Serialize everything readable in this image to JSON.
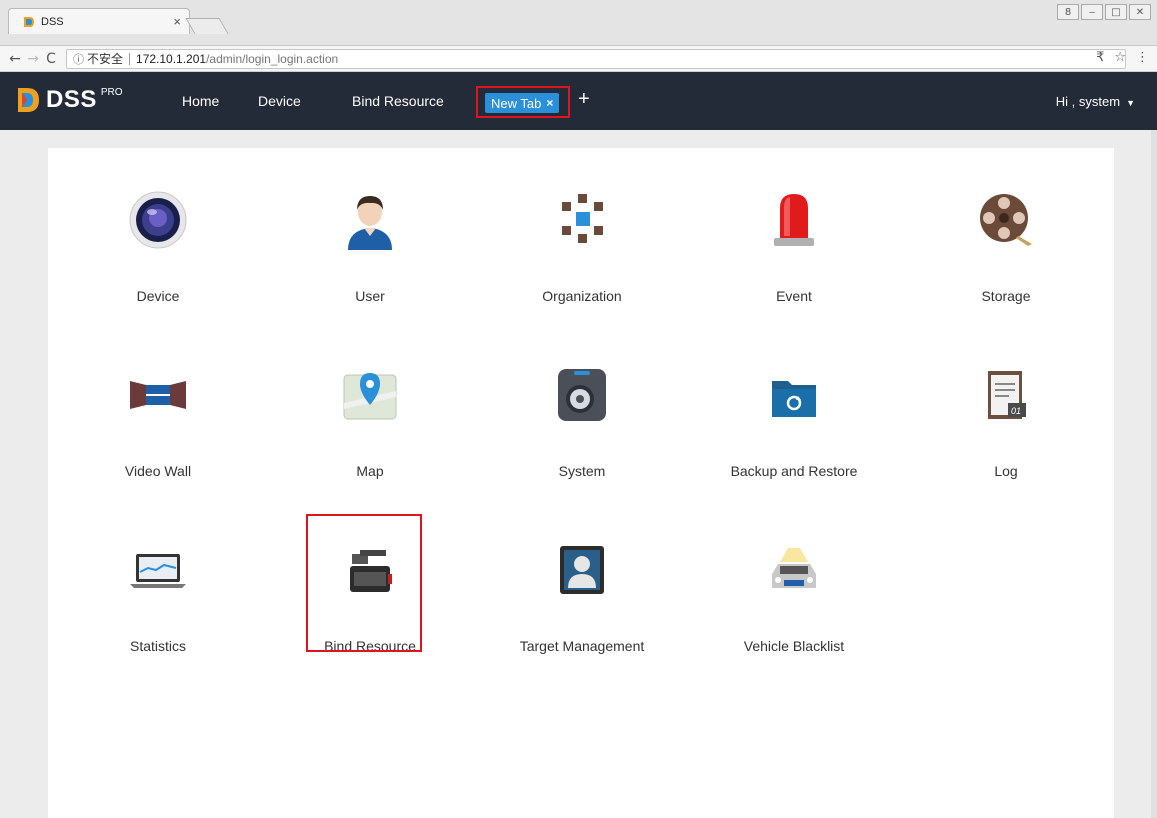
{
  "browser": {
    "tab_title": "DSS",
    "tab_close": "×",
    "security_text": "不安全",
    "url_host": "172.10.1.201",
    "url_path": "/admin/login_login.action",
    "win_buttons": [
      "8",
      "‒",
      "□",
      "✕"
    ]
  },
  "app": {
    "logo_text": "DSS",
    "logo_sup": "PRO",
    "nav": {
      "home": "Home",
      "device": "Device",
      "bind_resource": "Bind Resource",
      "new_tab": "New Tab",
      "new_tab_close": "×",
      "add": "+"
    },
    "user_greeting": "Hi , system",
    "colors": {
      "nav_bg": "#242b38",
      "accent": "#2a90d9",
      "highlight": "#e0141e"
    }
  },
  "modules": [
    {
      "label": "Device",
      "icon": "camera-lens-icon"
    },
    {
      "label": "User",
      "icon": "user-avatar-icon"
    },
    {
      "label": "Organization",
      "icon": "organization-cubes-icon"
    },
    {
      "label": "Event",
      "icon": "alarm-light-icon"
    },
    {
      "label": "Storage",
      "icon": "film-reel-icon"
    },
    {
      "label": "Video Wall",
      "icon": "video-wall-icon"
    },
    {
      "label": "Map",
      "icon": "map-pin-icon"
    },
    {
      "label": "System",
      "icon": "system-gear-icon"
    },
    {
      "label": "Backup and Restore",
      "icon": "backup-folder-icon"
    },
    {
      "label": "Log",
      "icon": "log-notepad-icon"
    },
    {
      "label": "Statistics",
      "icon": "statistics-laptop-icon"
    },
    {
      "label": "Bind Resource",
      "icon": "bind-resource-device-icon"
    },
    {
      "label": "Target Management",
      "icon": "target-face-icon"
    },
    {
      "label": "Vehicle Blacklist",
      "icon": "vehicle-car-icon"
    }
  ]
}
